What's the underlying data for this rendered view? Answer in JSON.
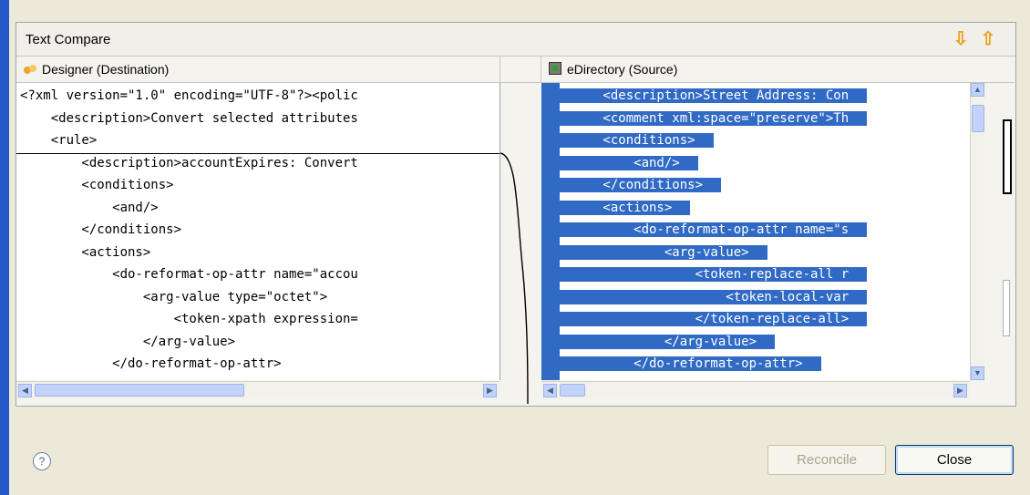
{
  "panel": {
    "title": "Text Compare",
    "next_diff_icon": "down-arrow-icon",
    "prev_diff_icon": "up-arrow-icon"
  },
  "left_pane": {
    "title": "Designer (Destination)",
    "icon": "designer-icon",
    "lines": [
      "<?xml version=\"1.0\" encoding=\"UTF-8\"?><polic",
      "    <description>Convert selected attributes",
      "    <rule>",
      "        <description>accountExpires: Convert",
      "        <conditions>",
      "            <and/>",
      "        </conditions>",
      "        <actions>",
      "            <do-reformat-op-attr name=\"accou",
      "                <arg-value type=\"octet\">",
      "                    <token-xpath expression=",
      "                </arg-value>",
      "            </do-reformat-op-attr>"
    ]
  },
  "right_pane": {
    "title": "eDirectory (Source)",
    "icon": "edirectory-icon",
    "lines": [
      "        <description>Street Address: Con",
      "        <comment xml:space=\"preserve\">Th",
      "        <conditions>",
      "            <and/>",
      "        </conditions>",
      "        <actions>",
      "            <do-reformat-op-attr name=\"s",
      "                <arg-value>",
      "                    <token-replace-all r",
      "                        <token-local-var",
      "                    </token-replace-all>",
      "                </arg-value>",
      "            </do-reformat-op-attr>"
    ]
  },
  "footer": {
    "help_icon": "help-icon",
    "reconcile_label": "Reconcile",
    "close_label": "Close"
  },
  "colors": {
    "selection": "#316ac5",
    "title_bar": "#2457c8",
    "nav_arrow": "#e8a317"
  }
}
